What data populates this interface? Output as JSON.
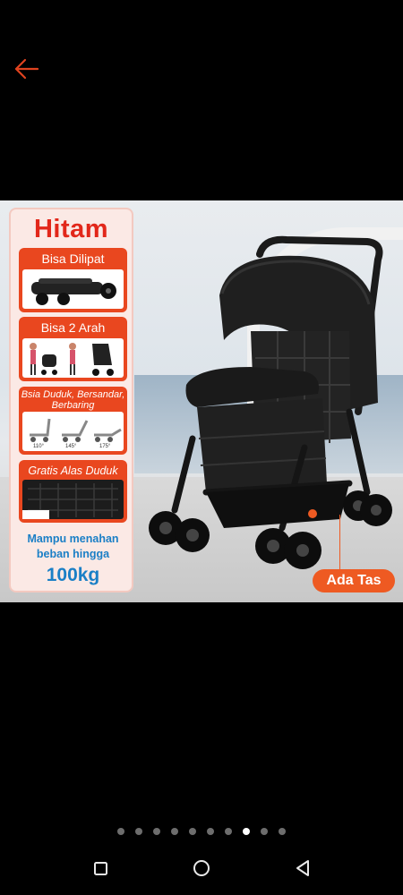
{
  "header": {
    "back_icon": "arrow-left-icon",
    "back_color": "#e0431f"
  },
  "product_image": {
    "panel_title": "Hitam",
    "features": [
      {
        "label": "Bisa Dilipat"
      },
      {
        "label": "Bisa 2 Arah"
      },
      {
        "label": "Bsia Duduk, Bersandar, Berbaring",
        "angles": [
          "110°",
          "145°",
          "175°"
        ]
      },
      {
        "label": "Gratis Alas Duduk"
      }
    ],
    "capacity": {
      "line1": "Mampu menahan",
      "line2": "beban hingga",
      "value": "100kg"
    },
    "callout": "Ada Tas",
    "accent_color": "#e9471f"
  },
  "carousel": {
    "count": 10,
    "active_index": 7
  },
  "navbar": {
    "buttons": [
      "recent-apps-icon",
      "home-icon",
      "back-triangle-icon"
    ]
  }
}
